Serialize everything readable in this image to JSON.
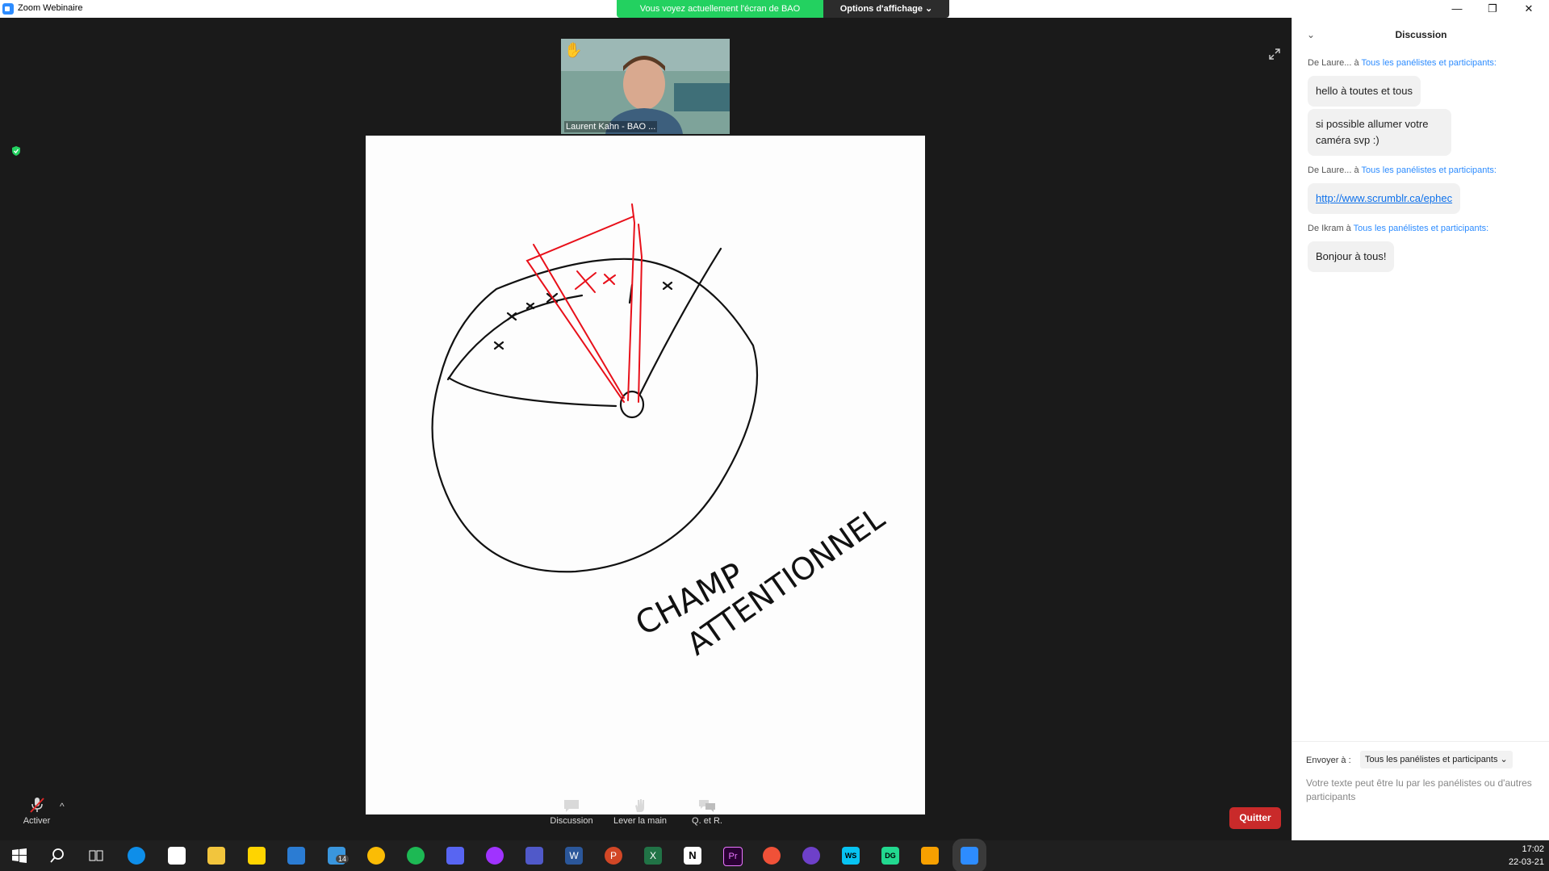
{
  "window": {
    "app_title": "Zoom Webinaire",
    "minimize": "—",
    "restore": "❐",
    "close": "✕"
  },
  "share_banner": {
    "text": "Vous voyez actuellement l'écran de BAO",
    "view_options": "Options d'affichage ⌄"
  },
  "video_thumbnail": {
    "name": "Laurent Kahn  - BAO ...",
    "raised_hand": "✋"
  },
  "drawing": {
    "caption_line1": "CHAMP",
    "caption_line2": "ATTENTIONNEL"
  },
  "toolbar": {
    "mic_label": "Activer",
    "mic_menu": "^",
    "items": [
      {
        "label": "Discussion",
        "icon": "chat-icon"
      },
      {
        "label": "Lever la main",
        "icon": "raise-hand-icon"
      },
      {
        "label": "Q. et R.",
        "icon": "qa-icon"
      }
    ],
    "quit_label": "Quitter"
  },
  "chat": {
    "title": "Discussion",
    "collapse_glyph": "⌄",
    "messages": [
      {
        "from": "De Laure...",
        "to_prefix": " à ",
        "to": "Tous les panélistes et participants:",
        "texts": [
          "hello à toutes et tous",
          "si possible allumer votre caméra svp :)"
        ]
      },
      {
        "from": "De Laure...",
        "to_prefix": " à ",
        "to": "Tous les panélistes et participants:",
        "link": "http://www.scrumblr.ca/ephec"
      },
      {
        "from": "De Ikram",
        "to_prefix": " à ",
        "to": "Tous les panélistes et participants:",
        "texts": [
          "Bonjour à tous!"
        ]
      }
    ],
    "send_to_label": "Envoyer à :",
    "send_to_value": "Tous les panélistes et participants ⌄",
    "compose_placeholder": "Votre texte peut être lu par les panélistes ou d'autres participants"
  },
  "taskbar": {
    "time": "17:02",
    "date": "22-03-21",
    "mail_badge": "14",
    "apps": [
      "windows-start-icon",
      "search-icon",
      "task-view-icon",
      "teamviewer-icon",
      "onedrive-icon",
      "file-explorer-icon",
      "sticky-notes-icon",
      "todo-icon",
      "mail-icon",
      "chrome-icon",
      "spotify-icon",
      "discord-icon",
      "messenger-icon",
      "teams-icon",
      "word-icon",
      "powerpoint-icon",
      "excel-icon",
      "notion-icon",
      "premiere-icon",
      "swift-icon",
      "github-icon",
      "webstorm-icon",
      "datagrip-icon",
      "snip-icon",
      "zoom-icon"
    ],
    "app_labels": {
      "premiere": "Pr",
      "word": "W",
      "excel": "X",
      "ppt": "P",
      "notion": "N",
      "webstorm": "WS",
      "datagrip": "DG"
    }
  },
  "colors": {
    "share_green": "#23d160",
    "quit_red": "#c92a2a",
    "link_blue": "#2d8cff",
    "drawing_red": "#e8101a"
  }
}
